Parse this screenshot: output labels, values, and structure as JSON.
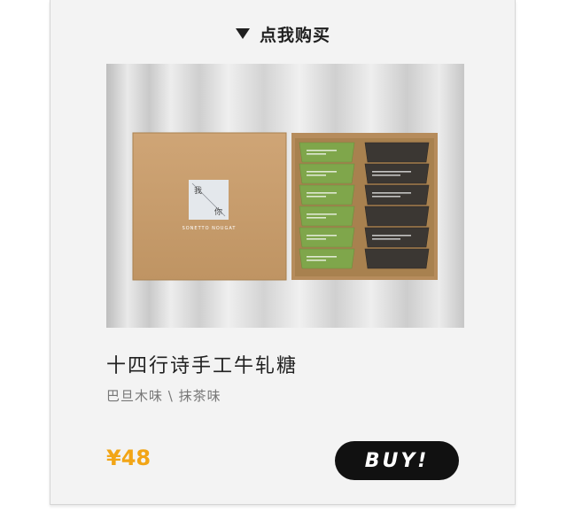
{
  "header": {
    "label": "点我购买",
    "icon": "triangle-down-icon"
  },
  "product": {
    "image_icon": "product-photo",
    "box_mark_top": "我",
    "box_mark_bottom": "你",
    "box_brand": "SONETTO NOUGAT",
    "title": "十四行诗手工牛轧糖",
    "flavors": "巴旦木味 \\ 抹茶味",
    "price": "¥48",
    "buy_label": "BUY!"
  },
  "colors": {
    "price": "#f2a516",
    "button": "#111111",
    "kraft": "#c89f6f",
    "matcha": "#7fa64b",
    "dark_candy": "#3b3733"
  }
}
